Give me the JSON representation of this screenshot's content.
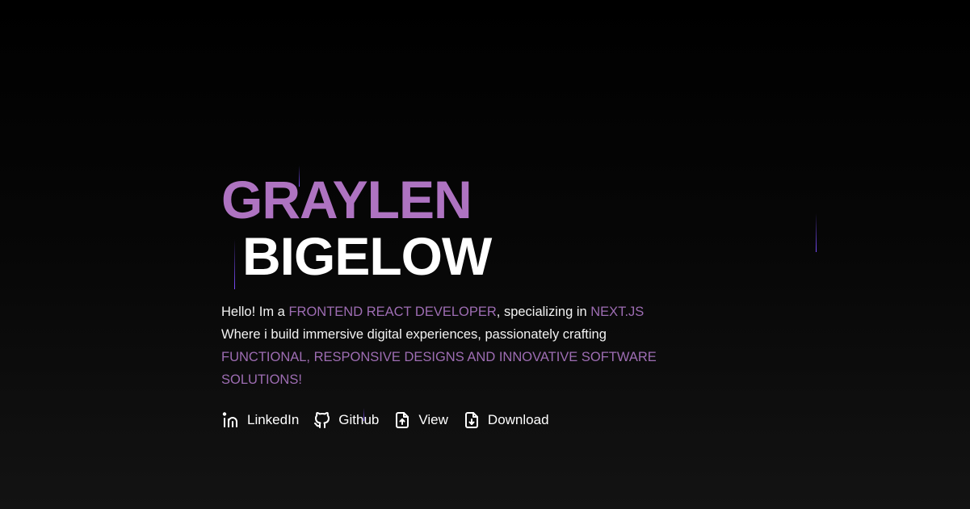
{
  "hero": {
    "first_name": "GRAYLEN",
    "last_name": "BIGELOW",
    "bio": {
      "p1": "Hello! Im a ",
      "hl1": "FRONTEND REACT DEVELOPER",
      "p2": ", specializing in ",
      "hl2": "NEXT.JS",
      "p3": " Where i build immersive digital experiences, passionately crafting ",
      "hl3": "FUNCTIONAL, RESPONSIVE DESIGNS AND INNOVATIVE SOFTWARE SOLUTIONS!"
    },
    "links": [
      {
        "label": "LinkedIn",
        "icon": "linkedin-icon"
      },
      {
        "label": "Github",
        "icon": "github-icon"
      },
      {
        "label": "View",
        "icon": "file-upload-icon"
      },
      {
        "label": "Download",
        "icon": "file-download-icon"
      }
    ]
  },
  "colors": {
    "accent": "#ae73c1",
    "streak": "#7c4dff",
    "background": "#000000"
  }
}
